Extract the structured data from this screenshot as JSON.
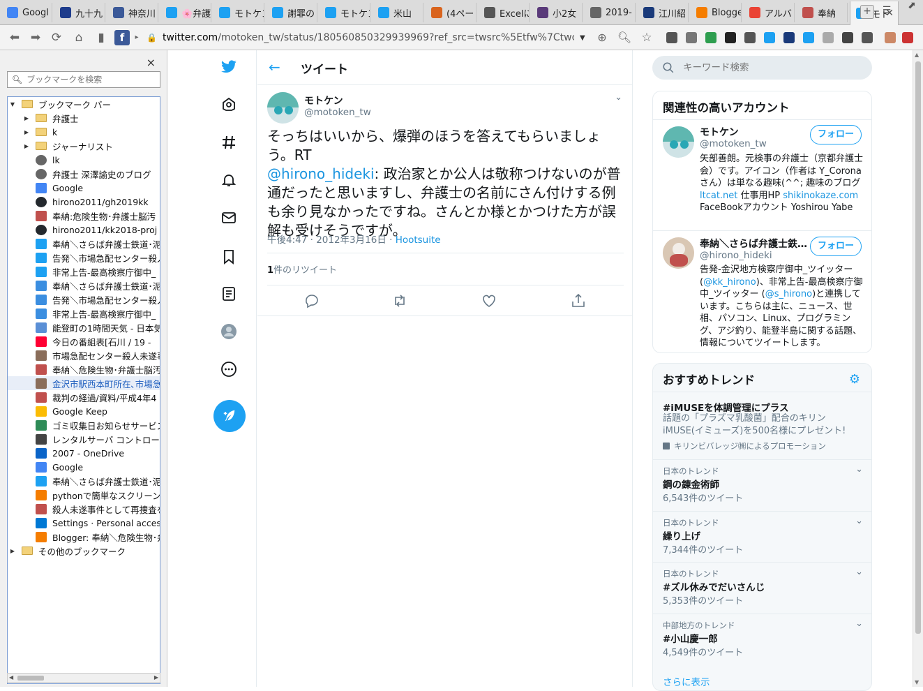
{
  "tabs": [
    {
      "label": "Googl",
      "icon": "google-docs-icon",
      "color": "#4285f4"
    },
    {
      "label": "九十九",
      "icon": "ship-icon",
      "color": "#1e3c8c"
    },
    {
      "label": "神奈川",
      "icon": "facebook-icon",
      "color": "#3b5998"
    },
    {
      "label": "🌸弁護",
      "icon": "twitter-icon",
      "color": "#1da1f2"
    },
    {
      "label": "モトケン",
      "icon": "twitter-icon",
      "color": "#1da1f2"
    },
    {
      "label": "謝罪の",
      "icon": "twitter-icon",
      "color": "#1da1f2"
    },
    {
      "label": "モトケン",
      "icon": "twitter-icon",
      "color": "#1da1f2"
    },
    {
      "label": "米山",
      "icon": "twitter-icon",
      "color": "#1da1f2"
    },
    {
      "label": "(4ペー",
      "icon": "site-icon",
      "color": "#d9641e"
    },
    {
      "label": "Excelに",
      "icon": "kanji-icon",
      "color": "#555555"
    },
    {
      "label": "小2女",
      "icon": "site-icon",
      "color": "#5a3a7a"
    },
    {
      "label": "2019-",
      "icon": "globe-icon",
      "color": "#666666"
    },
    {
      "label": "江川紹",
      "icon": "bj-icon",
      "color": "#1a3a7a"
    },
    {
      "label": "Blogge",
      "icon": "blogger-icon",
      "color": "#f57d00"
    },
    {
      "label": "アルバ",
      "icon": "photos-icon",
      "color": "#ea4335"
    },
    {
      "label": "奉納",
      "icon": "avatar-icon",
      "color": "#c0504d"
    },
    {
      "label": "モト",
      "icon": "twitter-icon",
      "color": "#1da1f2",
      "active": true
    }
  ],
  "toolbar": {
    "url_domain": "twitter.com",
    "url_rest": "/motoken_tw/status/180560850329939969?ref_src=twsrc%5Etfw%7Ctwc…"
  },
  "sidebar": {
    "search_placeholder": "ブックマークを検索",
    "close": "×",
    "root": "ブックマーク バー",
    "items": [
      {
        "label": "弁護士",
        "type": "folder"
      },
      {
        "label": "k",
        "type": "folder"
      },
      {
        "label": "ジャーナリスト",
        "type": "folder"
      },
      {
        "label": "lk",
        "type": "globe"
      },
      {
        "label": "弁護士 深澤諭史のブログ",
        "type": "globe"
      },
      {
        "label": "Google",
        "type": "google"
      },
      {
        "label": "hirono2011/gh2019kk",
        "type": "github"
      },
      {
        "label": "奉納:危険生物･弁護士脳汚",
        "type": "avatar"
      },
      {
        "label": "hirono2011/kk2018-proj",
        "type": "github"
      },
      {
        "label": "奉納＼さらば弁護士鉄道･泥",
        "type": "twitter"
      },
      {
        "label": "告発＼市場急配センター殺人",
        "type": "twitter"
      },
      {
        "label": "非常上告-最高検察庁御中_",
        "type": "twitter"
      },
      {
        "label": "奉納＼さらば弁護士鉄道･泥",
        "type": "tbox"
      },
      {
        "label": "告発＼市場急配センター殺人",
        "type": "tbox"
      },
      {
        "label": "非常上告-最高検察庁御中_",
        "type": "tbox"
      },
      {
        "label": "能登町の1時間天気 - 日本気",
        "type": "weather"
      },
      {
        "label": "今日の番組表[石川 / 19 -",
        "type": "yahoo"
      },
      {
        "label": "市場急配センター殺人未遂事",
        "type": "photo"
      },
      {
        "label": "奉納＼危険生物･弁護士脳汚",
        "type": "avatar"
      },
      {
        "label": "金沢市駅西本町所在､市場急",
        "type": "photo",
        "selected": true
      },
      {
        "label": "裁判の経過/資料/平成4年4",
        "type": "avatar"
      },
      {
        "label": "Google Keep",
        "type": "keep"
      },
      {
        "label": "ゴミ収集日お知らせサービス",
        "type": "garbage"
      },
      {
        "label": "レンタルサーバ コントロール",
        "type": "server"
      },
      {
        "label": "2007 - OneDrive",
        "type": "onedrive"
      },
      {
        "label": "Google",
        "type": "google"
      },
      {
        "label": "奉納＼さらば弁護士鉄道･泥",
        "type": "twitter"
      },
      {
        "label": "pythonで簡単なスクリーンシ",
        "type": "blogger"
      },
      {
        "label": "殺人未遂事件として再捜査を",
        "type": "avatar"
      },
      {
        "label": "Settings · Personal access",
        "type": "azure"
      },
      {
        "label": "Blogger: 奉納＼危険生物･弁",
        "type": "blogger"
      }
    ],
    "other": "その他のブックマーク"
  },
  "main": {
    "header_title": "ツイート",
    "author_name": "モトケン",
    "author_handle": "@motoken_tw",
    "tweet_line1": "そっちはいいから、爆弾のほうを答えてもらいましょう。RT",
    "tweet_mention": "@hirono_hideki",
    "tweet_rest": ": 政治家とか公人は敬称つけないのが普通だったと思いますし、弁護士の名前にさん付けする例も余り見なかったですね。さんとか様とかつけた方が誤解も受けそうですが。",
    "time": "午後4:47 · 2012年3月16日 · ",
    "source": "Hootsuite",
    "retweet_num": "1",
    "retweet_label": "件のリツイート"
  },
  "right": {
    "search_placeholder": "キーワード検索",
    "related_title": "関連性の高いアカウント",
    "accounts": [
      {
        "name": "モトケン",
        "handle": "@motoken_tw",
        "follow": "フォロー",
        "bio_a": "矢部善朗。元検事の弁護士（京都弁護士会）です。アイコン（作者は Y_Coronaさん）は単なる趣味(^^; 趣味のブログ ",
        "bio_l1": "ltcat.net",
        "bio_b": " 仕事用HP ",
        "bio_l2": "shikinokaze.com",
        "bio_c": " FaceBookアカウント Yoshirou Yabe"
      },
      {
        "name": "奉納＼さらば弁護士鉄…",
        "handle": "@hirono_hideki",
        "follow": "フォロー",
        "bio_a": "告発-金沢地方検察庁御中_ツイッター(",
        "bio_l1": "@kk_hirono",
        "bio_b": ")、非常上告-最高検察庁御中_ツイッター (",
        "bio_l2": "@s_hirono",
        "bio_c": ")と連携しています。こちらは主に、ニュース、世相、パソコン、Linux、プログラミング、アジ釣り、能登半島に関する話題、情報についてツイートします。"
      }
    ],
    "trends_title": "おすすめトレンド",
    "promo": {
      "name": "#iMUSEを体調管理にプラス",
      "desc": "話題の「プラズマ乳酸菌」配合のキリンiMUSE(イミューズ)を500名様にプレゼント!",
      "by": "キリンビバレッジ㈱によるプロモーション"
    },
    "trends": [
      {
        "category": "日本のトレンド",
        "name": "鋼の錬金術師",
        "count": "6,543件のツイート"
      },
      {
        "category": "日本のトレンド",
        "name": "繰り上げ",
        "count": "7,344件のツイート"
      },
      {
        "category": "日本のトレンド",
        "name": "#ズル休みでだいさんじ",
        "count": "5,353件のツイート"
      },
      {
        "category": "中部地方のトレンド",
        "name": "#小山慶一郎",
        "count": "4,549件のツイート"
      }
    ],
    "show_more": "さらに表示"
  },
  "colors": {
    "accent": "#1da1f2",
    "link": "#1b95e0",
    "secondary_text": "#657786"
  }
}
